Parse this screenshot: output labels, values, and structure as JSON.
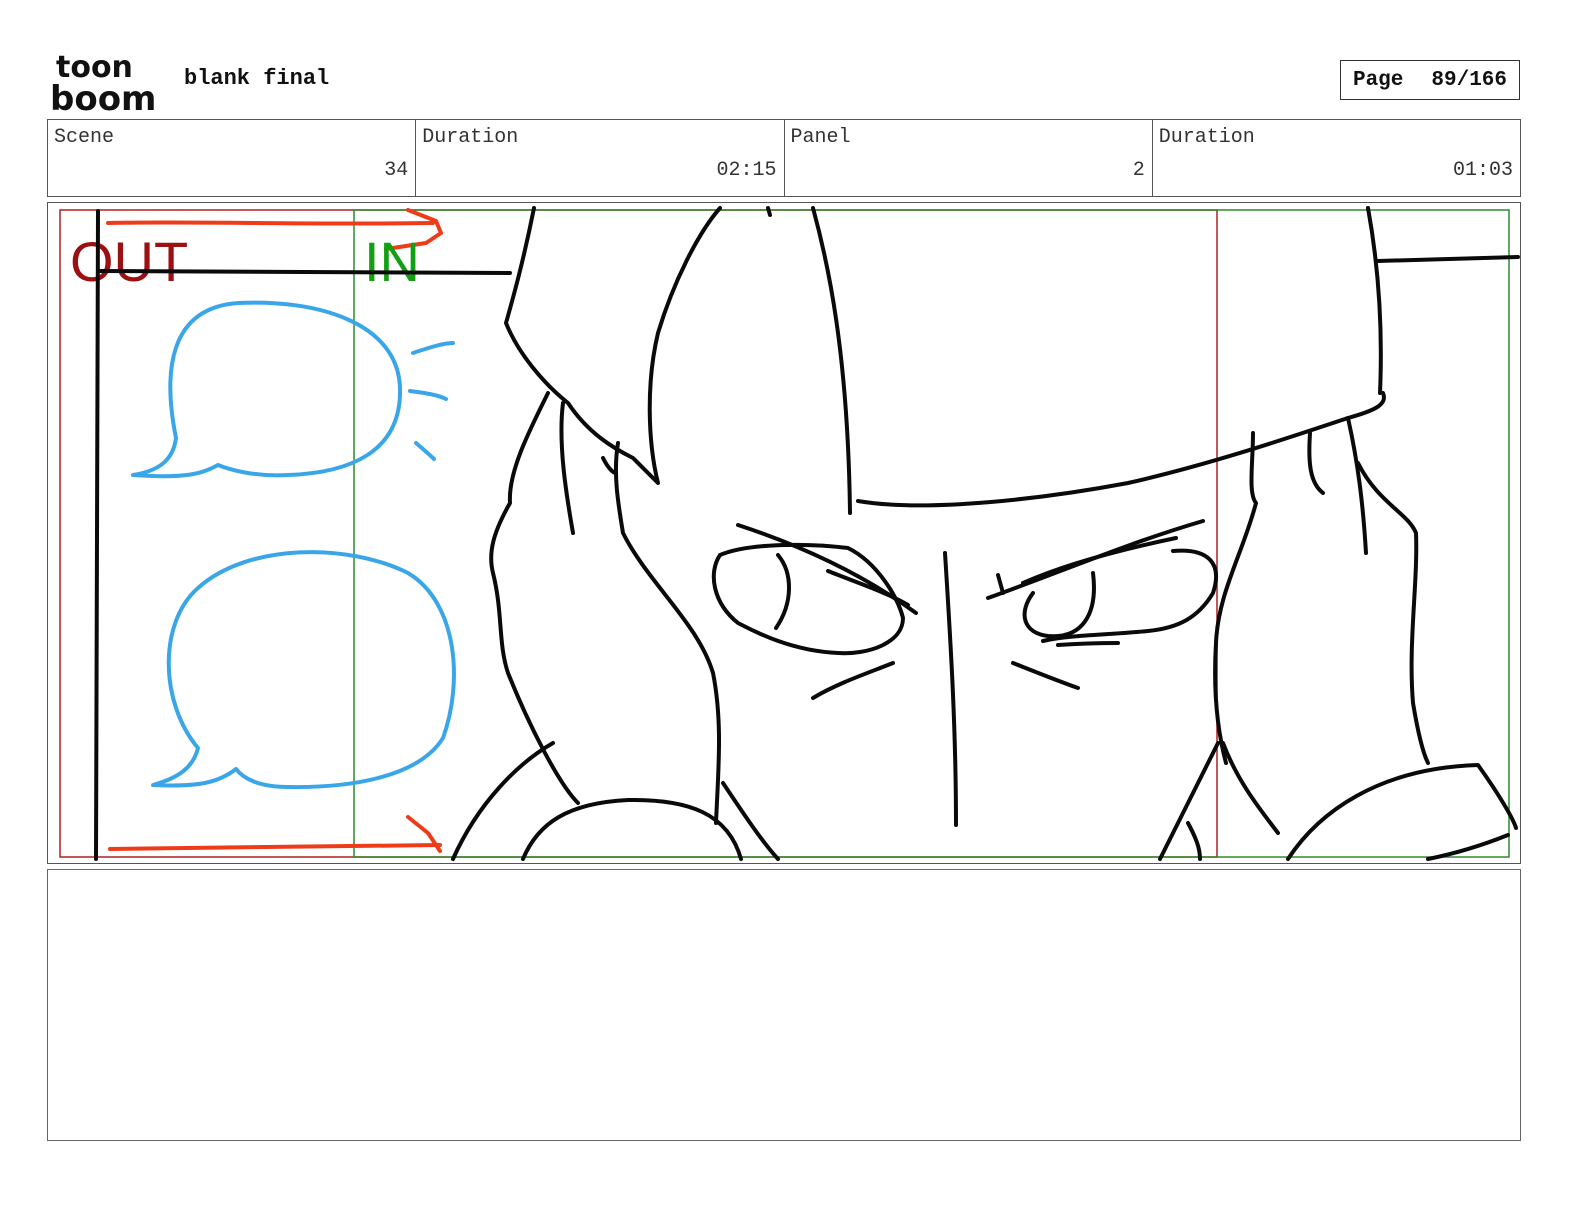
{
  "header": {
    "logo_top": "toon",
    "logo_bottom": "boom",
    "project_title": "blank final",
    "page_label": "Page",
    "page_value": "89/166"
  },
  "info": {
    "scene_label": "Scene",
    "scene_value": "34",
    "scene_duration_label": "Duration",
    "scene_duration_value": "02:15",
    "panel_label": "Panel",
    "panel_value": "2",
    "panel_duration_label": "Duration",
    "panel_duration_value": "01:03"
  },
  "panel": {
    "out_label": "OUT",
    "in_label": "IN",
    "colors": {
      "out_frame": "#b02020",
      "in_frame": "#2f8a2f",
      "out_text": "#9b1010",
      "in_text": "#11a011",
      "arrow": "#ee3b1a",
      "speech_bubble": "#3aa6e8",
      "ink": "#0a0a0a"
    }
  },
  "notes": {
    "text": ""
  }
}
